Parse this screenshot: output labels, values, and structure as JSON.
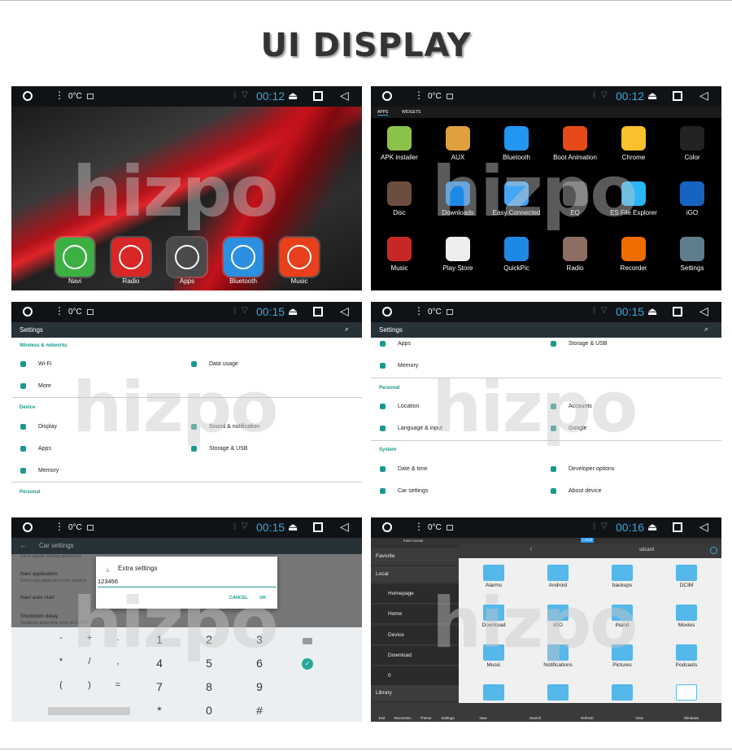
{
  "page_title": "UI DISPLAY",
  "watermark": "hizpo",
  "colors": {
    "accent": "#1a9a8e",
    "clock": "#3aa6dc",
    "folder": "#55b7ea"
  },
  "status_bars": [
    {
      "temp": "0°C",
      "time": "00:12"
    },
    {
      "temp": "0°C",
      "time": "00:12"
    },
    {
      "temp": "0°C",
      "time": "00:15"
    },
    {
      "temp": "0°C",
      "time": "00:15"
    },
    {
      "temp": "0°C",
      "time": "00:15"
    },
    {
      "temp": "0°C",
      "time": "00:16"
    }
  ],
  "home": {
    "dock": [
      {
        "label": "Navi",
        "icon": "navigation-icon",
        "color": "#3cb043"
      },
      {
        "label": "Radio",
        "icon": "radio-icon",
        "color": "#d92626"
      },
      {
        "label": "Apps",
        "icon": "apps-grid-icon",
        "color": "#4a4a4a"
      },
      {
        "label": "Bluetooth",
        "icon": "bluetooth-icon",
        "color": "#2d8fe0"
      },
      {
        "label": "Music",
        "icon": "music-icon",
        "color": "#e8401c"
      }
    ]
  },
  "app_drawer": {
    "tabs": [
      "APPS",
      "WIDGETS"
    ],
    "apps": [
      {
        "label": "APK installer",
        "color": "#8bc34a"
      },
      {
        "label": "AUX",
        "color": "#e0a040"
      },
      {
        "label": "Bluetooth",
        "color": "#2196f3"
      },
      {
        "label": "Boot Animation",
        "color": "#e64a19"
      },
      {
        "label": "Chrome",
        "color": "#fbc02d"
      },
      {
        "label": "Color",
        "color": "#222"
      },
      {
        "label": "Disc",
        "color": "#6d4c41"
      },
      {
        "label": "Downloads",
        "color": "#1e88e5"
      },
      {
        "label": "Easy Connected",
        "color": "#42a5f5"
      },
      {
        "label": "EQ",
        "color": "#555"
      },
      {
        "label": "ES File Explorer",
        "color": "#29b6f6"
      },
      {
        "label": "iGO",
        "color": "#1565c0"
      },
      {
        "label": "Music",
        "color": "#c62828"
      },
      {
        "label": "Play Store",
        "color": "#eee"
      },
      {
        "label": "QuickPic",
        "color": "#1e88e5"
      },
      {
        "label": "Radio",
        "color": "#8d6e63"
      },
      {
        "label": "Recorder",
        "color": "#ef6c00"
      },
      {
        "label": "Settings",
        "color": "#607d8b"
      }
    ]
  },
  "settings1": {
    "header": "Settings",
    "sections": [
      {
        "title": "Wireless & networks",
        "items": [
          "Wi-Fi",
          "Data usage",
          "More"
        ]
      },
      {
        "title": "Device",
        "items": [
          "Display",
          "Sound & notification",
          "Apps",
          "Storage & USB",
          "Memory"
        ]
      },
      {
        "title": "Personal",
        "items": []
      }
    ]
  },
  "settings2": {
    "header": "Settings",
    "top_items": [
      "Apps",
      "Storage & USB",
      "Memory"
    ],
    "sections": [
      {
        "title": "Personal",
        "items": [
          "Location",
          "Accounts",
          "Language & input",
          "Google"
        ]
      },
      {
        "title": "System",
        "items": [
          "Date & time",
          "Developer options",
          "Car settings",
          "About device"
        ]
      }
    ]
  },
  "car_settings": {
    "header": "Car settings",
    "rows": [
      {
        "title": "",
        "sub": "Set or update steering wheel keys"
      },
      {
        "title": "Navi application",
        "sub": "Select navi application from installed"
      },
      {
        "title": "Navi auto start",
        "sub": ""
      },
      {
        "title": "Shutdown delay",
        "sub": "Shutdown delay time when ACC OFF"
      }
    ],
    "dialog": {
      "title": "Extra settings",
      "value": "123456",
      "cancel": "CANCEL",
      "ok": "OK"
    },
    "keypad": [
      [
        "-",
        "+",
        ".",
        "1",
        "2",
        "3"
      ],
      [
        "*",
        "/",
        ",",
        "4",
        "5",
        "6"
      ],
      [
        "(",
        ")",
        "=",
        "7",
        "8",
        "9"
      ],
      [
        "",
        "",
        "",
        "*",
        "0",
        "#"
      ]
    ]
  },
  "file_manager": {
    "fast_access": "Fast Access",
    "location_tab": "Local",
    "path": [
      "/",
      "sdcard"
    ],
    "sidebar": [
      "Favorite",
      "Local",
      "Homepage",
      "Home",
      "Device",
      "Download",
      "0",
      "Library"
    ],
    "folders": [
      "Alarms",
      "Android",
      "backups",
      "DCIM",
      "Download",
      "iGO",
      "iNand",
      "Movies",
      "Music",
      "Notifications",
      "Pictures",
      "Podcasts",
      "",
      "",
      "",
      ""
    ],
    "bottom_left": [
      "Exit",
      "Recomme...",
      "Theme",
      "Settings"
    ],
    "bottom_right": [
      "New",
      "Search",
      "Refresh",
      "View",
      "Windows"
    ]
  }
}
